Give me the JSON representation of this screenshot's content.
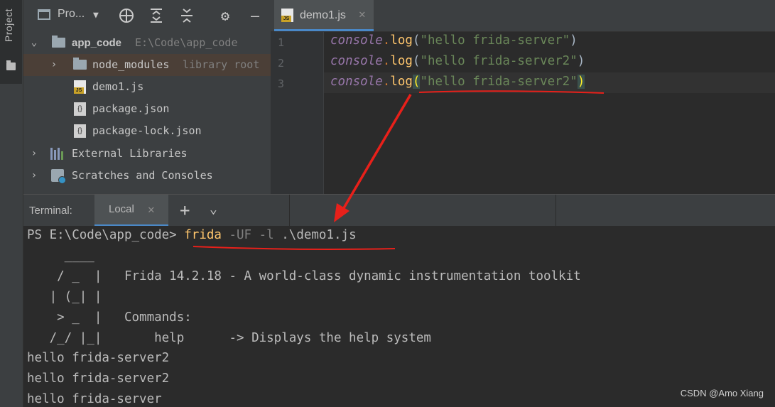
{
  "side_panel": {
    "tab_label": "Project"
  },
  "project_panel": {
    "title": "Pro...",
    "tree": [
      {
        "name": "app_code",
        "path": "E:\\Code\\app_code"
      },
      {
        "name": "node_modules",
        "note": "library root"
      },
      {
        "name": "demo1.js"
      },
      {
        "name": "package.json"
      },
      {
        "name": "package-lock.json"
      },
      {
        "name": "External Libraries"
      },
      {
        "name": "Scratches and Consoles"
      }
    ]
  },
  "editor": {
    "tab_label": "demo1.js",
    "line_numbers": [
      "1",
      "2",
      "3"
    ],
    "lines": [
      {
        "obj": "console",
        "dot": ".",
        "fn": "log",
        "open": "(",
        "str": "\"hello frida-server\"",
        "close": ")"
      },
      {
        "obj": "console",
        "dot": ".",
        "fn": "log",
        "open": "(",
        "str": "\"hello frida-server2\"",
        "close": ")"
      },
      {
        "obj": "console",
        "dot": ".",
        "fn": "log",
        "open": "(",
        "str": "\"hello frida-server2\"",
        "close": ")"
      }
    ]
  },
  "terminal": {
    "title": "Terminal:",
    "tab_label": "Local",
    "prompt": "PS E:\\Code\\app_code> ",
    "cmd_name": "frida",
    "cmd_opts": " -UF -l ",
    "cmd_arg": ".\\demo1.js",
    "banner": [
      "     ____",
      "    / _  |   Frida 14.2.18 - A world-class dynamic instrumentation toolkit",
      "   | (_| |",
      "    > _  |   Commands:",
      "   /_/ |_|       help      -> Displays the help system"
    ],
    "output": [
      "hello frida-server2",
      "hello frida-server2",
      "hello frida-server"
    ]
  },
  "watermark": "CSDN @Amo Xiang",
  "colors": {
    "annotation": "#e8201a",
    "accent": "#4a88c7"
  }
}
